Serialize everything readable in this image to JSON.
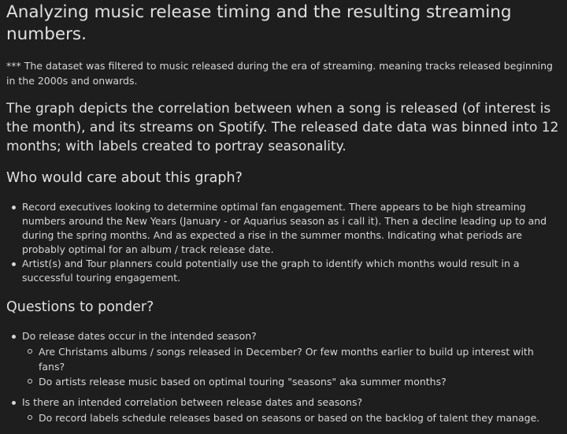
{
  "title": "Analyzing music release timing and the resulting streaming numbers.",
  "note": "*** The dataset was filtered to music released during the era of streaming. meaning tracks released beginning in the 2000s and onwards.",
  "lead": "The graph depicts the correlation between when a song is released (of interest is the month), and its streams on Spotify. The released date data was binned into 12 months; with labels created to portray seasonality.",
  "who_heading": "Who would care about this graph?",
  "who_items": [
    "Record executives looking to determine optimal fan engagement. There appears to be high streaming numbers around the New Years (January - or Aquarius season as i call it). Then a decline leading up to and during the spring months. And as expected a rise in the summer months. Indicating what periods are probably optimal for an album / track release date.",
    "Artist(s) and Tour planners could potentially use the graph to identify which months would result in a successful touring engagement."
  ],
  "questions_heading": "Questions to ponder?",
  "questions": [
    {
      "text": "Do release dates occur in the intended season?",
      "sub": [
        "Are Christams albums / songs released in December? Or few months earlier to build up interest with fans?",
        "Do artists release music based on optimal touring \"seasons\" aka summer months?"
      ]
    },
    {
      "text": "Is there an intended correlation between release dates and seasons?",
      "sub": [
        "Do record labels schedule releases based on seasons or based on the backlog of talent they manage."
      ]
    }
  ]
}
